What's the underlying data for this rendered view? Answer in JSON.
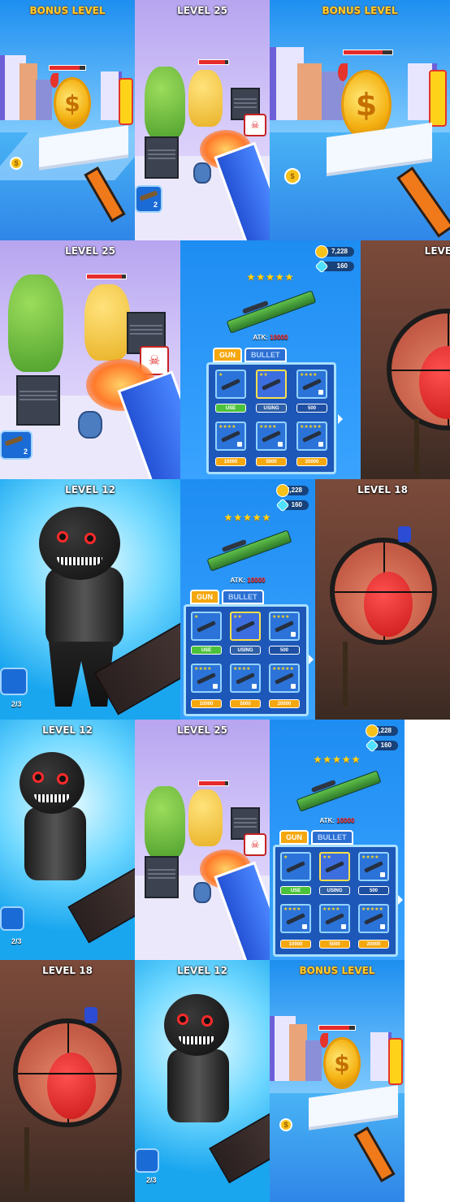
{
  "labels": {
    "bonus": "BONUS LEVEL",
    "l25": "LEVEL 25",
    "l12": "LEVEL 12",
    "l18": "LEVEL 18",
    "l18cut": "LEVE"
  },
  "hud": {
    "ammo_count": "2",
    "rockets": "2/3",
    "coin_symbol": "$"
  },
  "shop": {
    "coins": "7,228",
    "gems": "160",
    "stars": "★★★★★",
    "atk_label": "ATK:",
    "atk_value": "10000",
    "tab_gun": "GUN",
    "tab_bullet": "BULLET",
    "btn_use": "USE",
    "btn_using": "USING",
    "btn_500": "500",
    "btn_10000": "10000",
    "btn_5000": "5000",
    "btn_20000": "20000"
  },
  "colors": {
    "sky": "#1e8ff0",
    "shop_bg": "#1e8df2",
    "gold": "#f5a70e",
    "hp_red": "#e52b2b"
  }
}
